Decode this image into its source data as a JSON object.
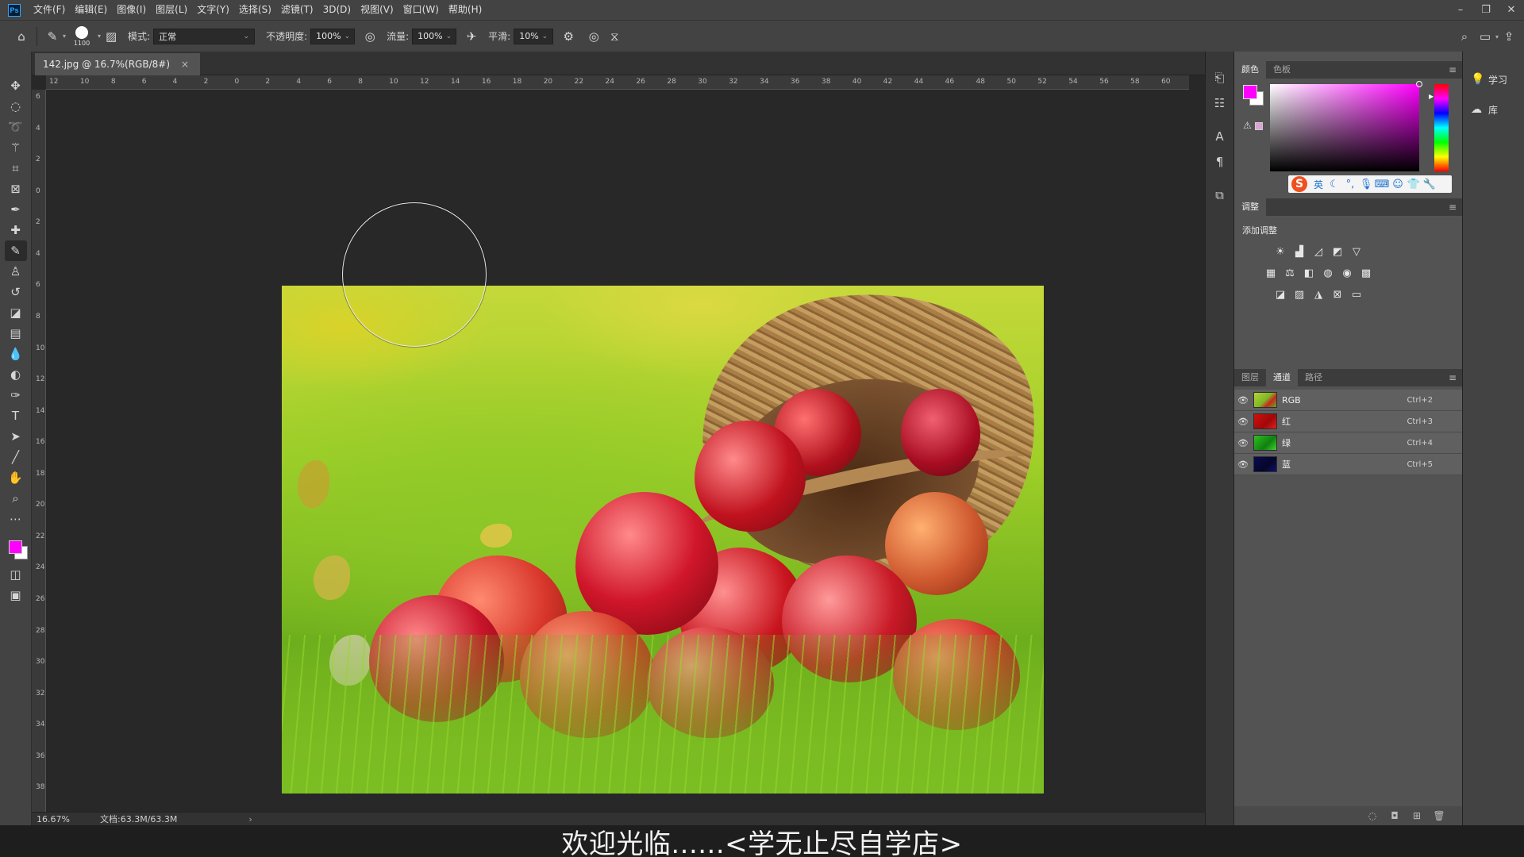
{
  "app": {
    "logo": "Ps"
  },
  "menu": [
    "文件(F)",
    "编辑(E)",
    "图像(I)",
    "图层(L)",
    "文字(Y)",
    "选择(S)",
    "滤镜(T)",
    "3D(D)",
    "视图(V)",
    "窗口(W)",
    "帮助(H)"
  ],
  "window_controls": {
    "minimize": "–",
    "restore": "❐",
    "close": "✕"
  },
  "options": {
    "brush_size": "1100",
    "mode_label": "模式:",
    "mode_value": "正常",
    "opacity_label": "不透明度:",
    "opacity_value": "100%",
    "flow_label": "流量:",
    "flow_value": "100%",
    "smoothing_label": "平滑:",
    "smoothing_value": "10%"
  },
  "document": {
    "tab_title": "142.jpg @ 16.7%(RGB/8#)",
    "tab_close": "×",
    "zoom": "16.67%",
    "info": "文档:63.3M/63.3M",
    "status_arrow": "›"
  },
  "rulers": {
    "top": [
      "12",
      "10",
      "8",
      "6",
      "4",
      "2",
      "0",
      "2",
      "4",
      "6",
      "8",
      "10",
      "12",
      "14",
      "16",
      "18",
      "20",
      "22",
      "24",
      "26",
      "28",
      "30",
      "32",
      "34",
      "36",
      "38",
      "40",
      "42",
      "44",
      "46",
      "48",
      "50",
      "52",
      "54",
      "56",
      "58",
      "60"
    ],
    "left": [
      "6",
      "4",
      "2",
      "0",
      "2",
      "4",
      "6",
      "8",
      "10",
      "12",
      "14",
      "16",
      "18",
      "20",
      "22",
      "24",
      "26",
      "28",
      "30",
      "32",
      "34",
      "36",
      "38"
    ]
  },
  "color_panel": {
    "tabs": [
      "颜色",
      "色板"
    ],
    "foreground": "#ff00ff",
    "background": "#ffffff",
    "warning": "⚠",
    "ime_language": "英"
  },
  "adjustments_panel": {
    "tab": "调整",
    "title": "添加调整"
  },
  "channels_panel": {
    "tabs": [
      "图层",
      "通道",
      "路径"
    ],
    "channels": [
      {
        "name": "RGB",
        "shortcut": "Ctrl+2"
      },
      {
        "name": "红",
        "shortcut": "Ctrl+3"
      },
      {
        "name": "绿",
        "shortcut": "Ctrl+4"
      },
      {
        "name": "蓝",
        "shortcut": "Ctrl+5"
      }
    ]
  },
  "right_strip": {
    "learn": "学习",
    "libraries": "库"
  },
  "subtitle": "欢迎光临......<学无止尽自学店>",
  "colors": {
    "accent": "#31a8ff",
    "foreground_swatch": "#ff00ff"
  }
}
